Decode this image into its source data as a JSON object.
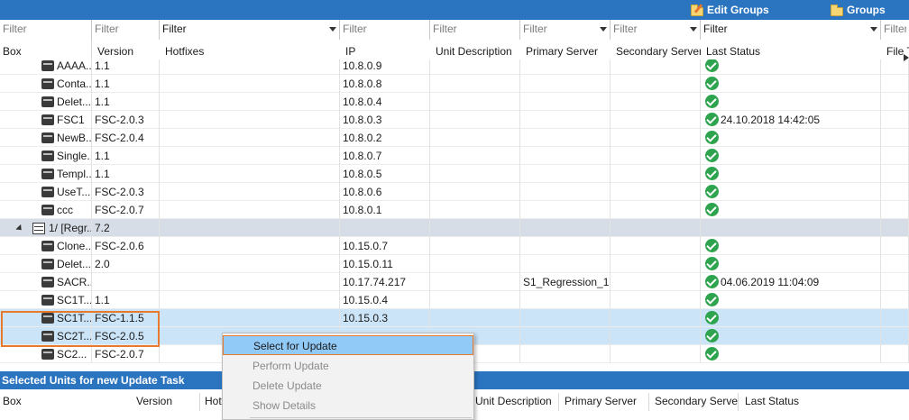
{
  "toolbar": {
    "edit_groups_label": "Edit Groups",
    "groups_label": "Groups"
  },
  "filters": {
    "placeholder": "Filter",
    "hotfixes_value": "Filter",
    "last_status_value": "Filter"
  },
  "columns": {
    "box": "Box",
    "version": "Version",
    "hotfixes": "Hotfixes",
    "ip": "IP",
    "unit_description": "Unit Description",
    "primary_server": "Primary Server",
    "secondary_server": "Secondary Server",
    "last_status": "Last Status",
    "file": "File T"
  },
  "rows": [
    {
      "kind": "unit",
      "box": "AAAA...",
      "version": "1.1",
      "ip": "10.8.0.9",
      "primary": "",
      "status": "ok",
      "status_text": ""
    },
    {
      "kind": "unit",
      "box": "Conta...",
      "version": "1.1",
      "ip": "10.8.0.8",
      "primary": "",
      "status": "ok",
      "status_text": ""
    },
    {
      "kind": "unit",
      "box": "Delet...",
      "version": "1.1",
      "ip": "10.8.0.4",
      "primary": "",
      "status": "ok",
      "status_text": ""
    },
    {
      "kind": "unit",
      "box": "FSC1",
      "version": "FSC-2.0.3",
      "ip": "10.8.0.3",
      "primary": "",
      "status": "ok",
      "status_text": "24.10.2018 14:42:05"
    },
    {
      "kind": "unit",
      "box": "NewB...",
      "version": "FSC-2.0.4",
      "ip": "10.8.0.2",
      "primary": "",
      "status": "ok",
      "status_text": ""
    },
    {
      "kind": "unit",
      "box": "Single...",
      "version": "1.1",
      "ip": "10.8.0.7",
      "primary": "",
      "status": "ok",
      "status_text": ""
    },
    {
      "kind": "unit",
      "box": "Templ...",
      "version": "1.1",
      "ip": "10.8.0.5",
      "primary": "",
      "status": "ok",
      "status_text": ""
    },
    {
      "kind": "unit",
      "box": "UseT...",
      "version": "FSC-2.0.3",
      "ip": "10.8.0.6",
      "primary": "",
      "status": "ok",
      "status_text": ""
    },
    {
      "kind": "unit",
      "box": "ccc",
      "version": "FSC-2.0.7",
      "ip": "10.8.0.1",
      "primary": "",
      "status": "ok",
      "status_text": ""
    },
    {
      "kind": "group",
      "box": "1/ [Regr...",
      "version": "7.2",
      "ip": "",
      "primary": "",
      "status": "",
      "status_text": ""
    },
    {
      "kind": "unit",
      "box": "Clone...",
      "version": "FSC-2.0.6",
      "ip": "10.15.0.7",
      "primary": "",
      "status": "ok",
      "status_text": ""
    },
    {
      "kind": "unit",
      "box": "Delet...",
      "version": "2.0",
      "ip": "10.15.0.11",
      "primary": "",
      "status": "ok",
      "status_text": ""
    },
    {
      "kind": "unit",
      "box": "SACR...",
      "version": "",
      "ip": "10.17.74.217",
      "primary": "S1_Regression_1",
      "status": "ok",
      "status_text": "04.06.2019 11:04:09"
    },
    {
      "kind": "unit",
      "box": "SC1T...",
      "version": "1.1",
      "ip": "10.15.0.4",
      "primary": "",
      "status": "ok",
      "status_text": ""
    },
    {
      "kind": "unit",
      "selected": true,
      "box": "SC1T...",
      "version": "FSC-1.1.5",
      "ip": "10.15.0.3",
      "primary": "",
      "status": "ok",
      "status_text": ""
    },
    {
      "kind": "unit",
      "selected": true,
      "box": "SC2T...",
      "version": "FSC-2.0.5",
      "ip": "",
      "primary": "",
      "status": "ok",
      "status_text": ""
    },
    {
      "kind": "unit",
      "box": "SC2...",
      "version": "FSC-2.0.7",
      "ip": "",
      "primary": "",
      "status": "ok",
      "status_text": ""
    }
  ],
  "selected_panel": {
    "title": "Selected Units for new Update Task",
    "columns": {
      "box": "Box",
      "version": "Version",
      "hotfixes": "Hotf",
      "unit_description": "Unit Description",
      "primary_server": "Primary Server",
      "secondary_server": "Secondary Server",
      "last_status": "Last Status"
    }
  },
  "context_menu": {
    "items": [
      {
        "label": "Select for Update",
        "enabled": true
      },
      {
        "label": "Perform Update",
        "enabled": false
      },
      {
        "label": "Delete Update",
        "enabled": false
      },
      {
        "label": "Show Details",
        "enabled": false
      }
    ]
  },
  "colors": {
    "accent": "#2b74c0",
    "selection": "#cce4f7",
    "highlight_outline": "#e97a2d",
    "status_ok": "#2ea44f"
  }
}
